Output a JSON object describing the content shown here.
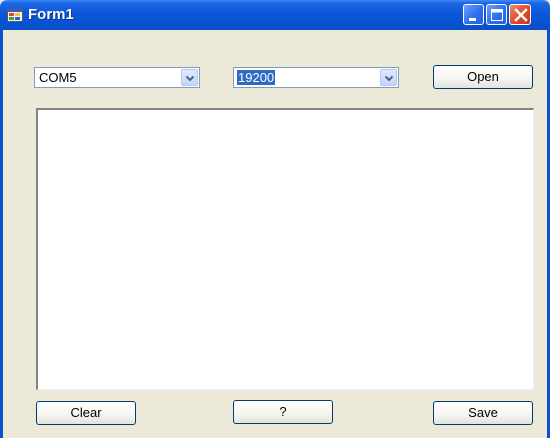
{
  "window": {
    "title": "Form1"
  },
  "port_combo": {
    "value": "COM5"
  },
  "baud_combo": {
    "value": "19200"
  },
  "buttons": {
    "open_label": "Open",
    "clear_label": "Clear",
    "help_label": "?",
    "save_label": "Save"
  },
  "output": {
    "text": ""
  },
  "icons": {
    "app": "form-app-icon",
    "minimize": "minimize-icon",
    "maximize": "maximize-icon",
    "close": "close-icon",
    "dropdown": "chevron-down-icon"
  },
  "colors": {
    "titlebar": "#0a57d6",
    "window_background": "#ece9d8",
    "selection": "#316ac5",
    "close_button": "#df4a24"
  }
}
